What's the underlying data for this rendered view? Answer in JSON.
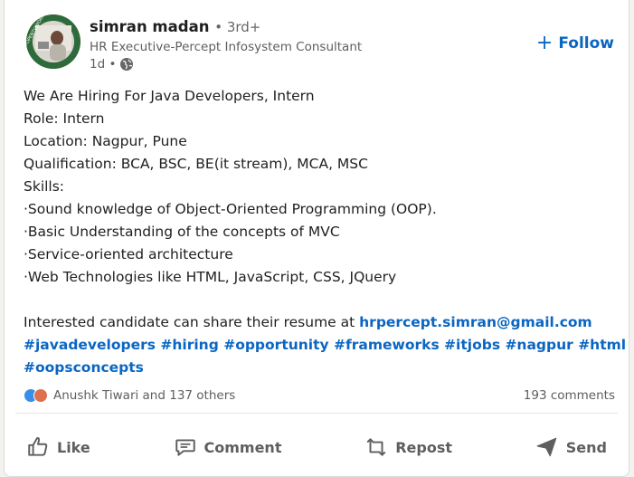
{
  "post": {
    "author": {
      "name": "simran madan",
      "degree": "• 3rd+",
      "headline": "HR Executive-Percept Infosystem Consultant",
      "time": "1d •",
      "avatar_badge_text": "#OPENTOWORK"
    },
    "follow_label": "Follow",
    "body": {
      "lines": [
        "We Are Hiring For Java Developers, Intern",
        "Role: Intern",
        "Location: Nagpur, Pune",
        "Qualification: BCA, BSC, BE(it stream), MCA, MSC",
        "Skills:",
        "·Sound knowledge of Object-Oriented Programming (OOP).",
        "·Basic Understanding of the concepts of MVC",
        "·Service-oriented architecture",
        "·Web Technologies like HTML, JavaScript, CSS, JQuery"
      ],
      "share_text": "Interested candidate can share their resume at ",
      "email": "hrpercept.simran@gmail.com",
      "hashtags_line1": "#javadevelopers #hiring #opportunity #frameworks #itjobs #nagpur #html",
      "hashtags_line2": "#oopsconcepts"
    },
    "social": {
      "reactions_text": "Anushk Tiwari and 137 others",
      "comments_text": "193 comments"
    },
    "actions": {
      "like": "Like",
      "comment": "Comment",
      "repost": "Repost",
      "send": "Send"
    },
    "colors": {
      "link": "#0a66c2",
      "avatar_ring": "#2f6b3a"
    }
  }
}
